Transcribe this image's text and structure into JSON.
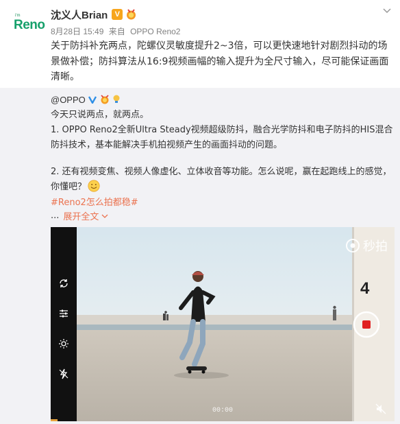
{
  "post": {
    "avatar_brand_small": "i'm",
    "avatar_brand": "Reno",
    "author": "沈义人Brian",
    "author_badge": "V",
    "date": "8月28日 15:49",
    "via_prefix": "来自",
    "device": "OPPO Reno2",
    "text": "关于防抖补充两点，陀螺仪灵敏度提升2~3倍，可以更快速地针对剧烈抖动的场景做补偿；防抖算法从16:9视频画幅的输入提升为全尺寸输入，尽可能保证画面清晰。"
  },
  "repost": {
    "author": "@OPPO",
    "line1": "今天只说两点，就两点。",
    "para1": "1. OPPO Reno2全新Ultra Steady视频超级防抖，融合光学防抖和电子防抖的HIS混合防抖技术，基本能解决手机拍视频产生的画面抖动的问题。",
    "para2": "2. 还有视频变焦、视频人像虚化、立体收音等功能。怎么说呢，赢在起跑线上的感觉，你懂吧？",
    "hashtag": "#Reno2怎么拍都稳#",
    "ellipsis": "...",
    "expand_label": "展开全文"
  },
  "video": {
    "brand": "秒拍",
    "timecode": "00:00",
    "wall_number": "4",
    "progress": 0.02
  },
  "colors": {
    "link": "#eb7350",
    "badge": "#f7a51c",
    "repost_bg": "#f2f2f5",
    "record": "#e02020"
  },
  "icons": [
    "chevron-down-icon",
    "verified-v-icon",
    "medal-icon",
    "lightbulb-icon",
    "smile-emoji-icon",
    "flip-camera-icon",
    "settings-sliders-icon",
    "brightness-icon",
    "flash-icon",
    "record-icon",
    "mute-icon",
    "miaopai-logo-icon"
  ]
}
